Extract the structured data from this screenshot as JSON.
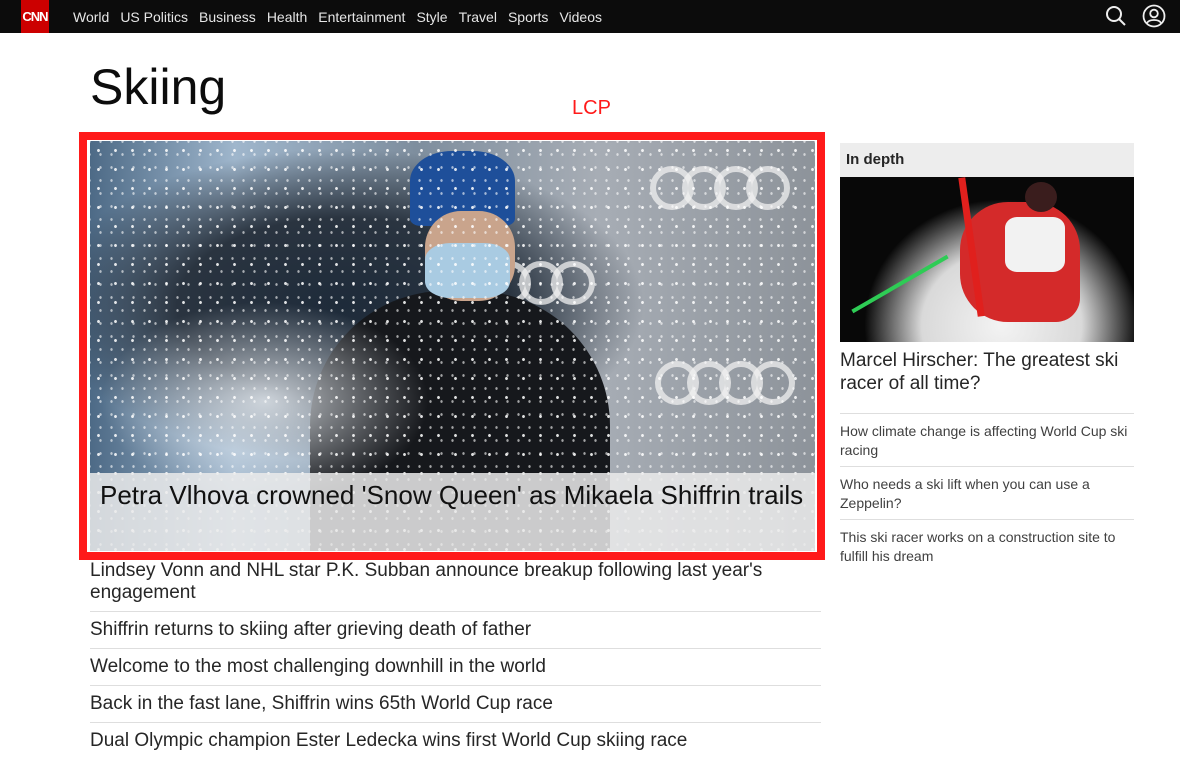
{
  "nav": {
    "logo": "CNN",
    "items": [
      "World",
      "US Politics",
      "Business",
      "Health",
      "Entertainment",
      "Style",
      "Travel",
      "Sports",
      "Videos"
    ],
    "brand_color": "#cc0000"
  },
  "page": {
    "title": "Skiing",
    "annotation": "LCP",
    "annotation_color": "#ff1a1a"
  },
  "hero": {
    "headline": "Petra Vlhova crowned 'Snow Queen' as Mikaela Shiffrin trails"
  },
  "headlines": [
    "Lindsey Vonn and NHL star P.K. Subban announce breakup following last year's engagement",
    "Shiffrin returns to skiing after grieving death of father",
    "Welcome to the most challenging downhill in the world",
    "Back in the fast lane, Shiffrin wins 65th World Cup race",
    "Dual Olympic champion Ester Ledecka wins first World Cup skiing race"
  ],
  "sidebar": {
    "heading": "In depth",
    "feature_title": "Marcel Hirscher: The greatest ski racer of all time?",
    "links": [
      "How climate change is affecting World Cup ski racing",
      "Who needs a ski lift when you can use a Zeppelin?",
      "This ski racer works on a construction site to fulfill his dream"
    ]
  }
}
